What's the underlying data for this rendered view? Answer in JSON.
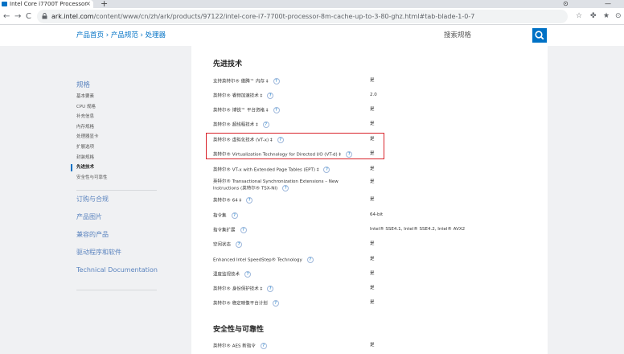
{
  "browser": {
    "tab_title": "Intel Core i7700T Processor",
    "tab_close": "×",
    "new_tab": "+",
    "window_controls": [
      "⊙",
      "—"
    ],
    "url_host": "ark.intel.com",
    "url_path": "/content/www/cn/zh/ark/products/97122/intel-core-i7-7700t-processor-8m-cache-up-to-3-80-ghz.html#tab-blade-1-0-7",
    "nav": {
      "back": "←",
      "forward": "→",
      "reload": "C"
    },
    "ext_icons": [
      "☆",
      "✤",
      "★",
      "⊙"
    ]
  },
  "header": {
    "breadcrumb": [
      "产品首页",
      "产品规范",
      "处理器"
    ],
    "breadcrumb_sep": "›",
    "search_placeholder": "搜索规格"
  },
  "sidebar": {
    "heading": "规格",
    "items": [
      {
        "label": "基本要素",
        "active": false
      },
      {
        "label": "CPU 规格",
        "active": false
      },
      {
        "label": "补充信息",
        "active": false
      },
      {
        "label": "内存规格",
        "active": false
      },
      {
        "label": "处理器显卡",
        "active": false
      },
      {
        "label": "扩展选项",
        "active": false
      },
      {
        "label": "封装规格",
        "active": false
      },
      {
        "label": "先进技术",
        "active": true
      },
      {
        "label": "安全性与可靠性",
        "active": false
      }
    ],
    "links": [
      "订购与合规",
      "产品图片",
      "兼容的产品",
      "驱动程序和软件",
      "Technical Documentation"
    ]
  },
  "main": {
    "section1_title": "先进技术",
    "rows": [
      {
        "label": "支持英特尔® 傲腾™ 内存 ‡",
        "value": "是"
      },
      {
        "label": "英特尔® 睿频加速技术 ‡",
        "value": "2.0"
      },
      {
        "label": "英特尔® 博锐™ 平台资格 ‡",
        "value": "是"
      },
      {
        "label": "英特尔® 超线程技术 ‡",
        "value": "是"
      },
      {
        "label": "英特尔® 虚拟化技术 (VT-x) ‡",
        "value": "是"
      },
      {
        "label": "英特尔® Virtualization Technology for Directed I/O (VT-d) ‡",
        "value": "是"
      },
      {
        "label": "英特尔® VT-x with Extended Page Tables (EPT) ‡",
        "value": "是"
      },
      {
        "label": "英特尔® Transactional Synchronization Extensions – New",
        "label2": "Instructions (英特尔® TSX-NI)",
        "value": "是"
      },
      {
        "label": "英特尔® 64 ‡",
        "value": "是"
      },
      {
        "label": "指令集",
        "value": "64-bit"
      },
      {
        "label": "指令集扩展",
        "value": "Intel® SSE4.1, Intel® SSE4.2, Intel® AVX2"
      },
      {
        "label": "空闲状态",
        "value": "是"
      },
      {
        "label": "Enhanced Intel SpeedStep® Technology",
        "value": "是"
      },
      {
        "label": "温度监视技术",
        "value": "是"
      },
      {
        "label": "英特尔® 身份保护技术 ‡",
        "value": "是"
      },
      {
        "label": "英特尔® 稳定映像平台计划",
        "value": "是"
      }
    ],
    "section2_title": "安全性与可靠性",
    "rows2": [
      {
        "label": "英特尔® AES 新指令",
        "value": "是"
      }
    ],
    "help_glyph": "?"
  }
}
